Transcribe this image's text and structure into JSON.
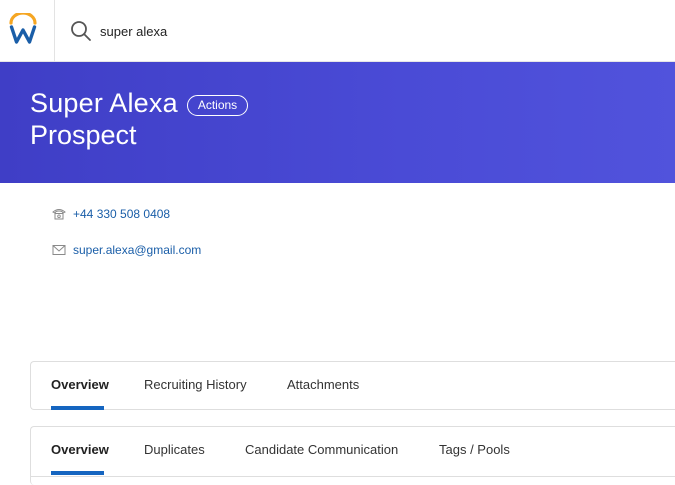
{
  "search": {
    "value": "super alexa"
  },
  "header": {
    "name": "Super Alexa",
    "actions_label": "Actions",
    "subtitle": "Prospect"
  },
  "contact": {
    "phone": "+44 330 508 0408",
    "email": "super.alexa@gmail.com"
  },
  "tabs_primary": [
    {
      "label": "Overview",
      "active": true
    },
    {
      "label": "Recruiting History",
      "active": false
    },
    {
      "label": "Attachments",
      "active": false
    }
  ],
  "tabs_secondary": [
    {
      "label": "Overview",
      "active": true
    },
    {
      "label": "Duplicates",
      "active": false
    },
    {
      "label": "Candidate Communication",
      "active": false
    },
    {
      "label": "Tags / Pools",
      "active": false
    }
  ],
  "icons": {
    "logo": "workday-logo-icon",
    "search": "search-icon",
    "phone": "phone-icon",
    "email": "envelope-icon"
  },
  "colors": {
    "banner": "#4547d0",
    "link": "#1a5ea8",
    "tab_underline": "#1565c0",
    "logo_arc": "#f5a623",
    "logo_w": "#1a5ea8"
  }
}
